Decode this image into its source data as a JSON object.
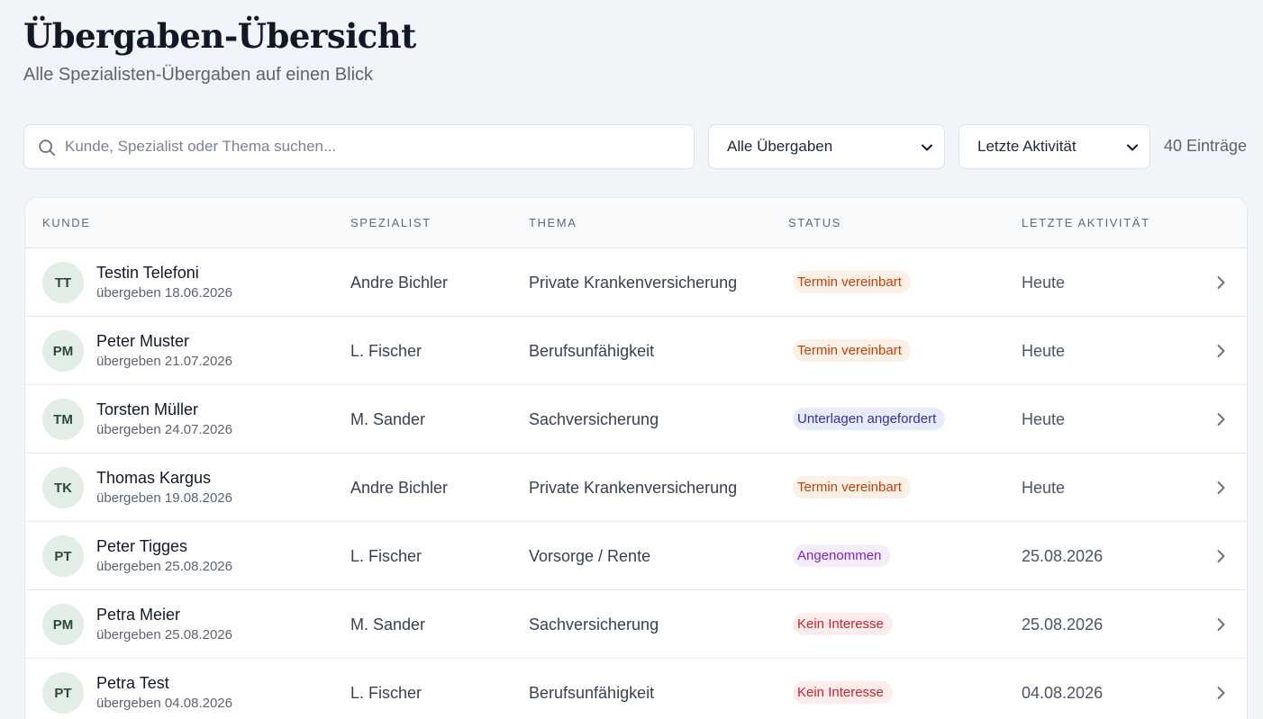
{
  "header": {
    "title": "Übergaben-Übersicht",
    "subtitle": "Alle Spezialisten-Übergaben auf einen Blick"
  },
  "toolbar": {
    "search_placeholder": "Kunde, Spezialist oder Thema suchen...",
    "search_icon": "search-icon",
    "filter_value": "Alle Übergaben",
    "sort_value": "Letzte Aktivität",
    "count": "40 Einträge"
  },
  "table": {
    "columns": [
      "Kunde",
      "Spezialist",
      "Thema",
      "Status",
      "Letzte Aktivität"
    ],
    "rows": [
      {
        "initials": "TT",
        "name": "Testin Telefoni",
        "handover": "übergeben 18.06.2026",
        "specialist": "Andre Bichler",
        "topic": "Private Krankenversicherung",
        "status": "Termin vereinbart",
        "status_kind": "termin",
        "activity": "Heute"
      },
      {
        "initials": "PM",
        "name": "Peter Muster",
        "handover": "übergeben 21.07.2026",
        "specialist": "L. Fischer",
        "topic": "Berufsunfähigkeit",
        "status": "Termin vereinbart",
        "status_kind": "termin",
        "activity": "Heute"
      },
      {
        "initials": "TM",
        "name": "Torsten Müller",
        "handover": "übergeben 24.07.2026",
        "specialist": "M. Sander",
        "topic": "Sachversicherung",
        "status": "Unterlagen angefordert",
        "status_kind": "unterlagen",
        "activity": "Heute"
      },
      {
        "initials": "TK",
        "name": "Thomas Kargus",
        "handover": "übergeben 19.08.2026",
        "specialist": "Andre Bichler",
        "topic": "Private Krankenversicherung",
        "status": "Termin vereinbart",
        "status_kind": "termin",
        "activity": "Heute"
      },
      {
        "initials": "PT",
        "name": "Peter Tigges",
        "handover": "übergeben 25.08.2026",
        "specialist": "L. Fischer",
        "topic": "Vorsorge / Rente",
        "status": "Angenommen",
        "status_kind": "angenommen",
        "activity": "25.08.2026"
      },
      {
        "initials": "PM",
        "name": "Petra Meier",
        "handover": "übergeben 25.08.2026",
        "specialist": "M. Sander",
        "topic": "Sachversicherung",
        "status": "Kein Interesse",
        "status_kind": "kein",
        "activity": "25.08.2026"
      },
      {
        "initials": "PT",
        "name": "Petra Test",
        "handover": "übergeben 04.08.2026",
        "specialist": "L. Fischer",
        "topic": "Berufsunfähigkeit",
        "status": "Kein Interesse",
        "status_kind": "kein",
        "activity": "04.08.2026"
      }
    ]
  },
  "colors": {
    "background": "#f1f4f8",
    "termin": "#c2410c",
    "unterlagen": "#3730a3",
    "angenommen": "#7e22ce",
    "kein_interesse": "#c8242c"
  }
}
